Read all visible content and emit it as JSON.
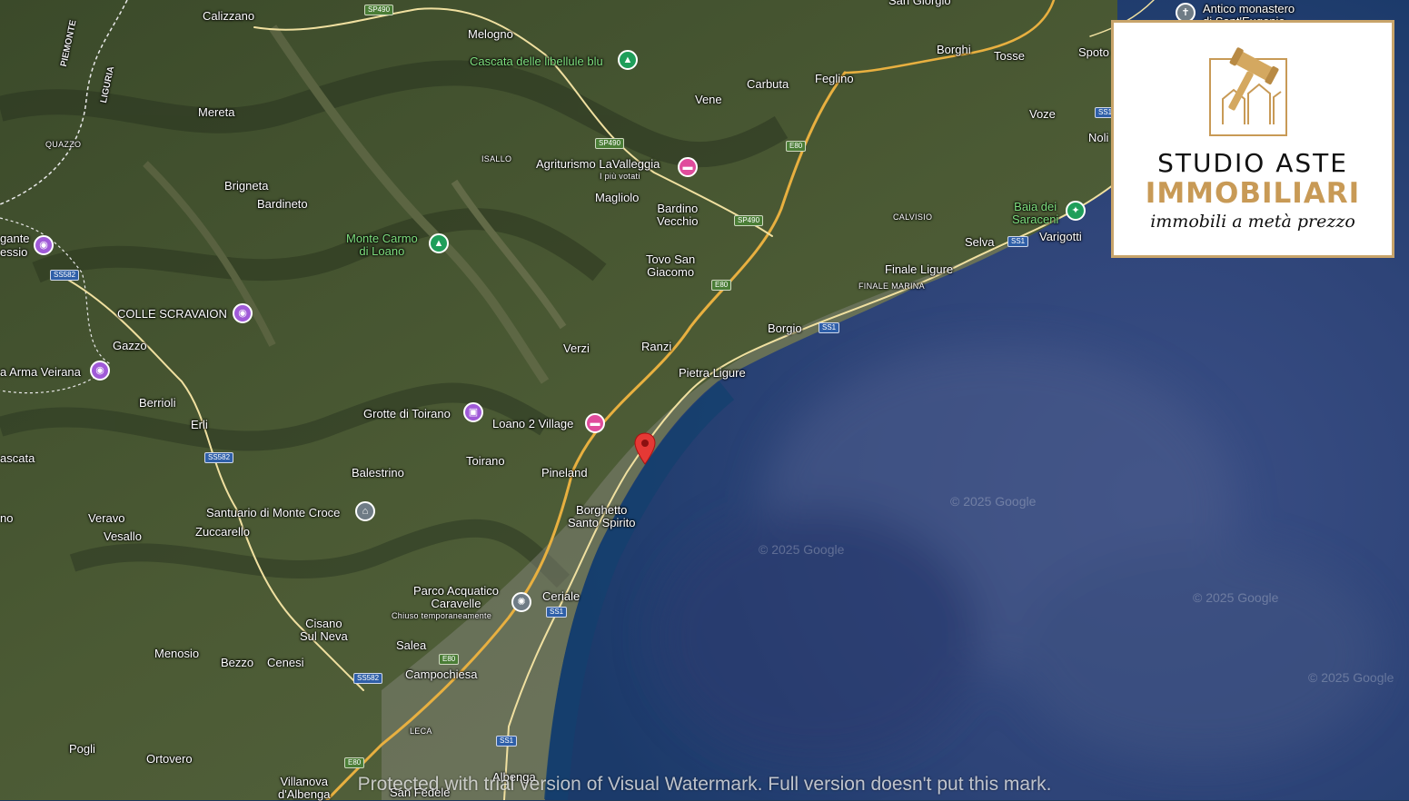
{
  "map": {
    "labels": {
      "calizzano": "Calizzano",
      "melogno": "Melogno",
      "san_giorgio": "San Giorgio",
      "piemonte": "PIEMONTE",
      "liguria": "LIGURIA",
      "mereta": "Mereta",
      "quazzo": "QUAZZO",
      "isallo": "ISALLO",
      "brigneta": "Brigneta",
      "bardineto": "Bardineto",
      "gante": "gante",
      "essio": "essio",
      "colle_scravaion": "COLLE SCRAVAION",
      "gazzo": "Gazzo",
      "arma_veirana": "a Arma Veirana",
      "berrioli": "Berrioli",
      "erli": "Erli",
      "cascata": "ascata",
      "balestrino": "Balestrino",
      "verzi": "Verzi",
      "ranzi": "Ranzi",
      "toirano": "Toirano",
      "pineland": "Pineland",
      "verravo": "Veravo",
      "vesallo": "Vesallo",
      "zuccarello": "Zuccarello",
      "no_edge": "no",
      "cisano_1": "Cisano",
      "cisano_2": "Sul Neva",
      "menosio": "Menosio",
      "bezzo": "Bezzo",
      "cenesi": "Cenesi",
      "salea": "Salea",
      "campochiesa": "Campochiesa",
      "leca": "LECA",
      "pogli": "Pogli",
      "ortovero": "Ortovero",
      "villanova_1": "Villanova",
      "villanova_2": "d'Albenga",
      "san_fedele": "San Fedele",
      "albenga": "Albenga",
      "ceriale": "Ceriale",
      "borghetto_1": "Borghetto",
      "borghetto_2": "Santo Spirito",
      "pietra_ligure": "Pietra Ligure",
      "borgio": "Borgio",
      "finale_ligure": "Finale Ligure",
      "finale_marina": "FINALE MARINA",
      "tovo_1": "Tovo San",
      "tovo_2": "Giacomo",
      "bardino_1": "Bardino",
      "bardino_2": "Vecchio",
      "magliolo": "Magliolo",
      "vene": "Vene",
      "carbuta": "Carbuta",
      "feglino": "Feglino",
      "borghi": "Borghi",
      "tosse": "Tosse",
      "spoto": "Spoto",
      "voze": "Voze",
      "noli": "Noli",
      "calvisio": "CALVISIO",
      "selva": "Selva",
      "varigotti": "Varigotti",
      "antico_1": "Antico monastero",
      "antico_2": "di Sant'Eugenio"
    },
    "pois": {
      "cascata_libellule": "Cascata delle libellule blu",
      "agriturismo": "Agriturismo LaValleggia",
      "agriturismo_sub": "I più votati",
      "monte_carmo_1": "Monte Carmo",
      "monte_carmo_2": "di Loano",
      "grotte_toirano": "Grotte di Toirano",
      "loano_village": "Loano 2 Village",
      "santuario": "Santuario di Monte Croce",
      "parco_1": "Parco Acquatico",
      "parco_2": "Caravelle",
      "parco_sub": "Chiuso temporaneamente",
      "baia_1": "Baia dei",
      "baia_2": "Saraceni"
    },
    "roads": {
      "sp490_a": "SP490",
      "sp490_b": "SP490",
      "sp490_c": "SP490",
      "e80_a": "E80",
      "e80_b": "E80",
      "e80_c": "E80",
      "e80_d": "E80",
      "ss582_a": "SS582",
      "ss582_b": "SS582",
      "ss582_c": "SS582",
      "ss1_a": "SS1",
      "ss1_b": "SS1",
      "ss1_c": "SS1",
      "ss1_d": "SS1",
      "ss1_e": "SS1"
    },
    "copyright": "© 2025 Google"
  },
  "logo": {
    "line1": "STUDIO ASTE",
    "line2": "IMMOBILIARI",
    "line3": "immobili a metà prezzo"
  },
  "watermark": "Protected with trial version of Visual Watermark. Full version doesn't put this mark."
}
